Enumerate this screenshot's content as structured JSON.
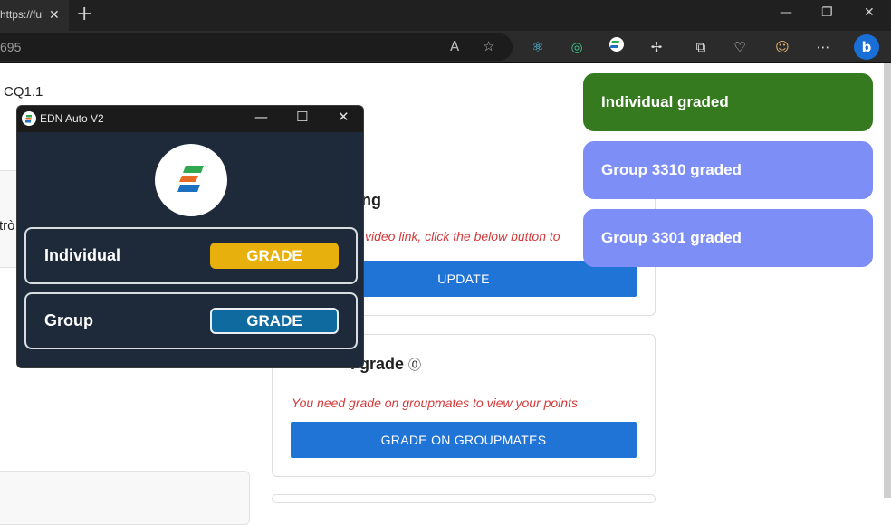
{
  "browser": {
    "tab_title": "https://fu",
    "url_fragment": "695"
  },
  "page": {
    "breadcrumb": "CQ1.1",
    "left_fragment": "trò",
    "meeting_card": {
      "title": "eeting",
      "note": "video link, click the below button to",
      "button": "UPDATE"
    },
    "grade_card": {
      "title": "l grade",
      "note": "You need grade on groupmates to view your points",
      "button": "GRADE ON GROUPMATES"
    }
  },
  "toasts": [
    {
      "text": "Individual graded",
      "color": "#367a1f"
    },
    {
      "text": "Group 3310 graded",
      "color": "#7d8ef7"
    },
    {
      "text": "Group 3301 graded",
      "color": "#7d8ef7"
    }
  ],
  "app": {
    "title": "EDN Auto V2",
    "individual_label": "Individual",
    "individual_button": "GRADE",
    "group_label": "Group",
    "group_button": "GRADE",
    "colors": {
      "yellow": "#e8b00c",
      "blue": "#0f6aa0"
    }
  }
}
